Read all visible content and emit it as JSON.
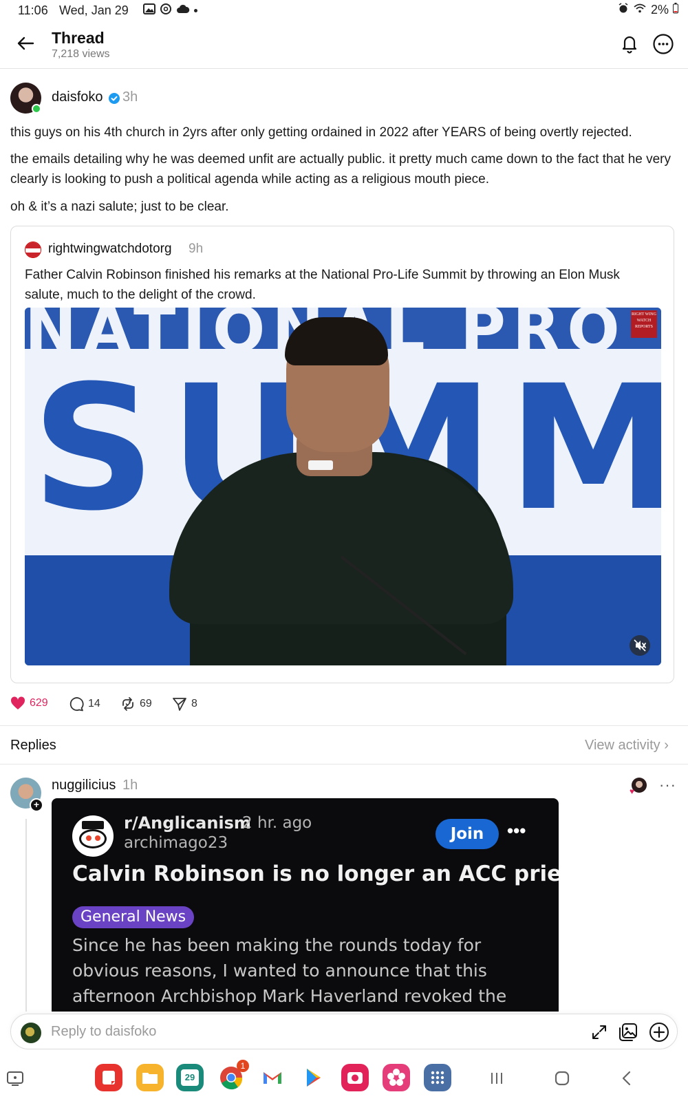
{
  "status_bar": {
    "time": "11:06",
    "date": "Wed, Jan 29",
    "battery": "2%"
  },
  "header": {
    "title": "Thread",
    "views": "7,218 views"
  },
  "post": {
    "username": "daisfoko",
    "time": "3h",
    "paragraphs": [
      "this guys on his 4th church in 2yrs after only getting ordained in 2022 after YEARS of being overtly rejected.",
      "the emails detailing why he was deemed unfit are actually public. it pretty much came down to the fact that he very clearly is looking to push a political agenda while acting as a religious mouth piece.",
      "oh & it’s a nazi salute; just to be clear."
    ],
    "quote": {
      "username": "rightwingwatchdotorg",
      "time": "9h",
      "text": "Father Calvin Robinson finished his remarks at the National Pro-Life Summit by throwing an Elon Musk salute, much to the delight of the crowd.",
      "video": {
        "banner_top": "NATIONAL PRO-L",
        "banner_main": "SUMM",
        "watermark": "RIGHT WING WATCH REPORTS"
      }
    },
    "actions": {
      "likes": "629",
      "comments": "14",
      "reposts": "69",
      "shares": "8"
    }
  },
  "replies_section": {
    "label": "Replies",
    "view_activity": "View activity ›"
  },
  "reply": {
    "username": "nuggilicius",
    "time": "1h",
    "reddit": {
      "subreddit": "r/Anglicanism",
      "time": "2 hr. ago",
      "author": "archimago23",
      "join": "Join",
      "title": "Calvin Robinson is no longer an ACC priest",
      "flair": "General News",
      "body": "Since he has been making the rounds today for obvious reasons, I wanted to announce that this afternoon Archbishop Mark Haverland revoked the clerical license"
    }
  },
  "composer": {
    "placeholder": "Reply to daisfoko"
  },
  "navbar": {
    "calendar_day": "29",
    "chrome_badge": "1"
  },
  "colors": {
    "like": "#e0245e",
    "verified": "#1d9bf0",
    "join_button": "#1967d2",
    "flair": "#6a43c4"
  }
}
